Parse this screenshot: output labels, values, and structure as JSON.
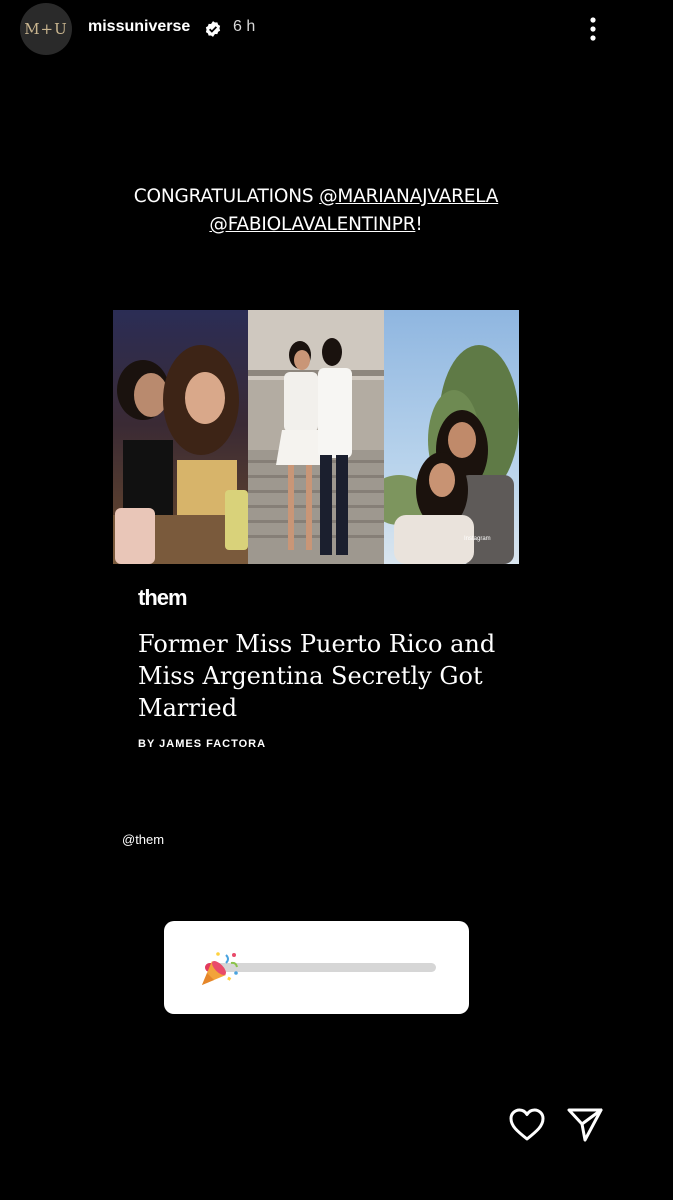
{
  "header": {
    "avatar_text": "M+U",
    "username": "missuniverse",
    "timestamp": "6 h",
    "verified_icon": "verified-badge-icon",
    "more_icon": "more-vertical-icon"
  },
  "story": {
    "text_prefix": "CONGRATULATIONS ",
    "mention_1": "@MARIANAJVARELA",
    "mention_2": "@FABIOLAVALENTINPR",
    "text_suffix": "!"
  },
  "article": {
    "brand": "them",
    "headline": "Former Miss Puerto Rico and Miss Argentina Secretly Got Married",
    "byline": "BY JAMES FACTORA",
    "photo_caption": "Instagram",
    "source_tag": "@them"
  },
  "slider_sticker": {
    "emoji": "party-popper-icon",
    "value": 0.06,
    "fill_color": "#e33a5e"
  },
  "footer": {
    "like_icon": "heart-icon",
    "share_icon": "send-icon"
  },
  "colors": {
    "background": "#000000",
    "text": "#ffffff"
  }
}
